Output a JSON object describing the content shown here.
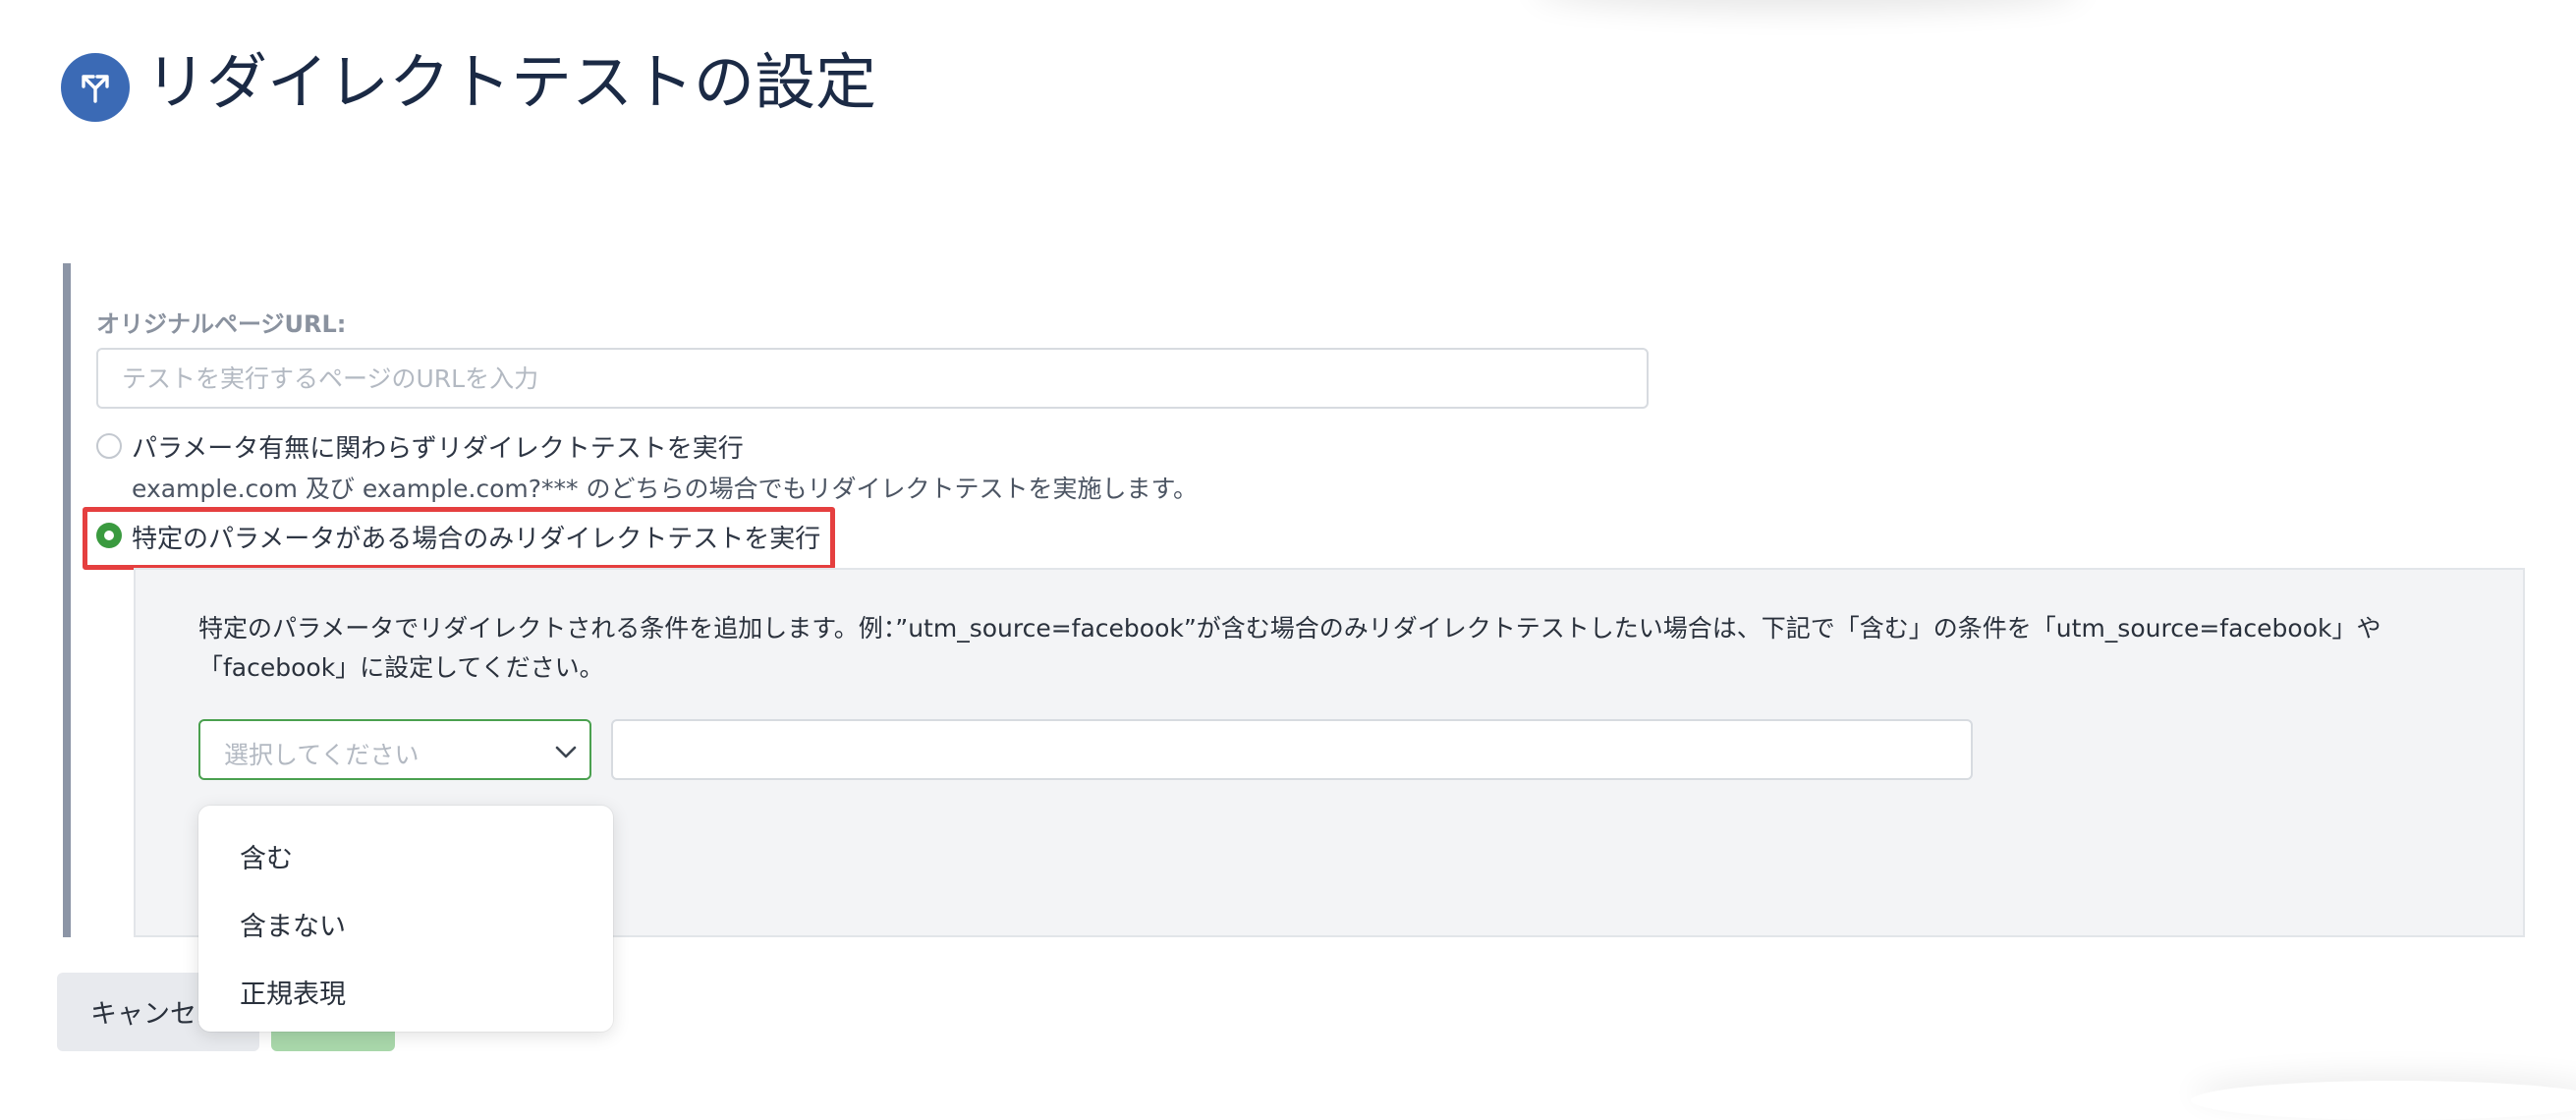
{
  "header": {
    "title": "リダイレクトテストの設定",
    "icon": "redirect-split-icon",
    "icon_color": "#3b6ab5"
  },
  "form": {
    "url_label": "オリジナルページURL:",
    "url_placeholder": "テストを実行するページのURLを入力",
    "url_value": "",
    "option_all": {
      "label": "パラメータ有無に関わらずリダイレクトテストを実行",
      "description": "example.com 及び example.com?*** のどちらの場合でもリダイレクトテストを実施します。",
      "selected": false
    },
    "option_specific": {
      "label": "特定のパラメータがある場合のみリダイレクトテストを実行",
      "selected": true
    },
    "conditions": {
      "description": "特定のパラメータでリダイレクトされる条件を追加します。例：”utm_source=facebook”が含む場合のみリダイレクトテストしたい場合は、下記で「含む」の条件を「utm_source=facebook」や「facebook」に設定してください。",
      "select_placeholder": "選択してください",
      "value": "",
      "options": [
        "含む",
        "含まない",
        "正規表現"
      ]
    }
  },
  "footer": {
    "cancel_label": "キャンセル",
    "save_label": ""
  },
  "colors": {
    "accent_green": "#3a9a3f",
    "highlight_red": "#e53f3f",
    "save_disabled": "#a9d8ab"
  }
}
